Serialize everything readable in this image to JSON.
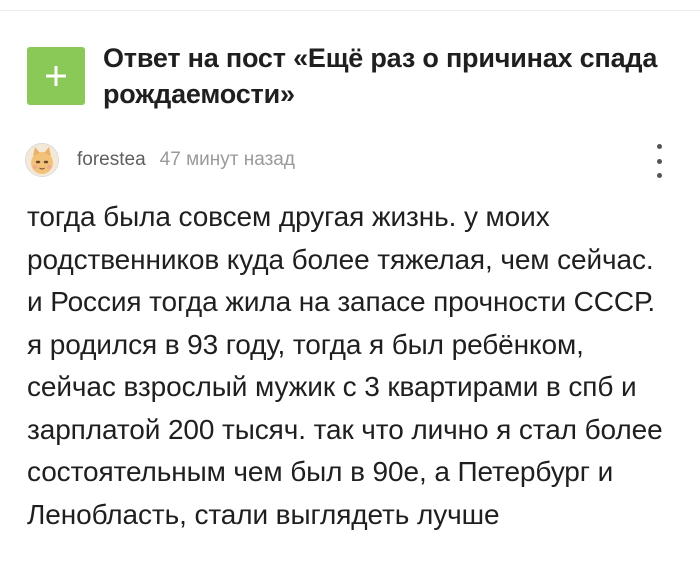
{
  "post": {
    "title": "Ответ на пост «Ещё раз о причинах спада рождаемости»",
    "badge_icon": "plus-icon",
    "badge_color": "#8ac858"
  },
  "comment": {
    "author": "forestea",
    "timestamp": "47 минут назад",
    "avatar_icon": "avatar-cat-face",
    "menu_icon": "vertical-dots-icon",
    "text": "тогда была совсем другая жизнь. у моих родственников куда более тяжелая, чем сейчас. и Россия тогда жила на запасе прочности СССР. я родился в 93 году, тогда я был ребёнком, сейчас взрослый мужик с 3 квартирами в спб и зарплатой 200 тысяч. так что лично я стал более состоятельным чем был в 90е, а Петербург и Ленобласть, стали выглядеть лучше"
  }
}
